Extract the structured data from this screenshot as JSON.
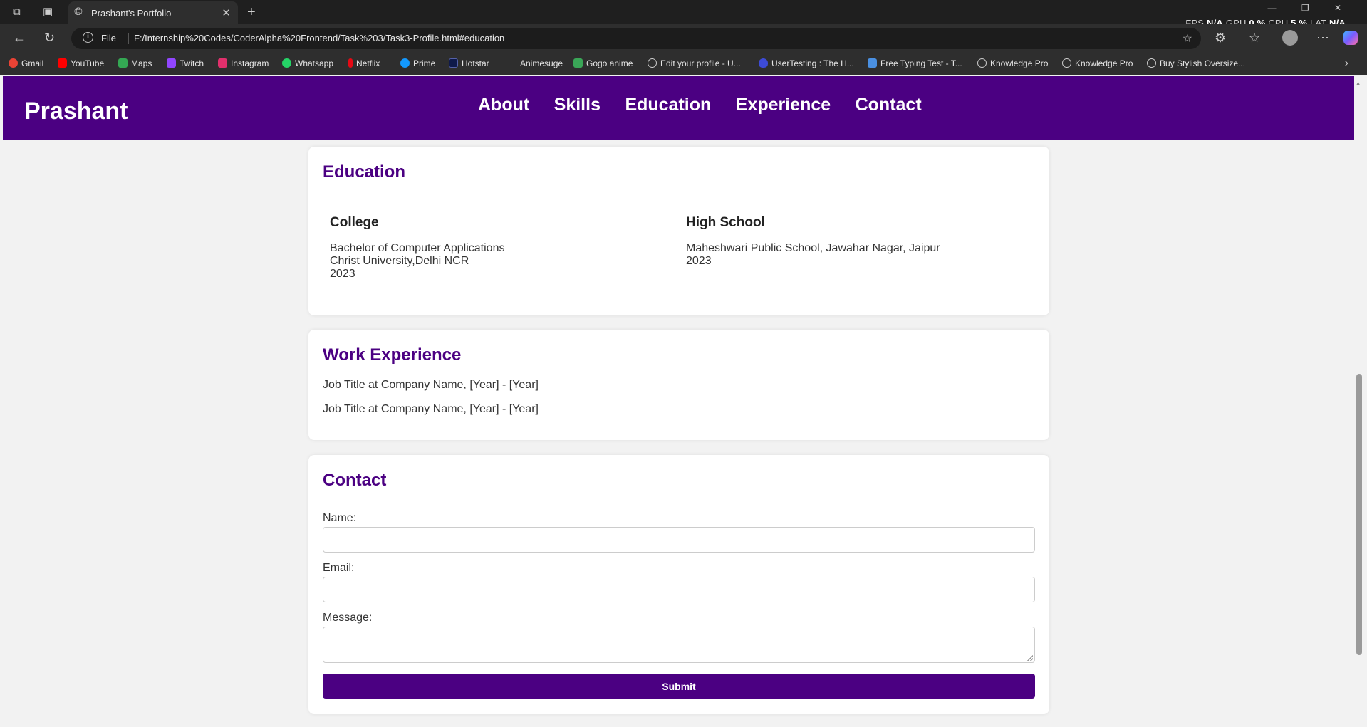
{
  "browser": {
    "tab_title": "Prashant's Portfolio",
    "address_prefix": "File",
    "url": "F:/Internship%20Codes/CoderAlpha%20Frontend/Task%203/Task3-Profile.html#education",
    "stats": {
      "fps_label": "FPS",
      "fps_value": "N/A",
      "gpu_label": "GPU",
      "gpu_value": "0 %",
      "cpu_label": "CPU",
      "cpu_value": "5 %",
      "lat_label": "LAT",
      "lat_value": "N/A"
    },
    "bookmarks": [
      {
        "label": "Gmail",
        "icon": "gmail-icon",
        "color": "#ea4335"
      },
      {
        "label": "YouTube",
        "icon": "youtube-icon",
        "color": "#ff0000"
      },
      {
        "label": "Maps",
        "icon": "maps-icon",
        "color": "#34a853"
      },
      {
        "label": "Twitch",
        "icon": "twitch-icon",
        "color": "#9146ff"
      },
      {
        "label": "Instagram",
        "icon": "instagram-icon",
        "color": "#e1306c"
      },
      {
        "label": "Whatsapp",
        "icon": "whatsapp-icon",
        "color": "#25d366"
      },
      {
        "label": "Netflix",
        "icon": "netflix-icon",
        "color": "#e50914"
      },
      {
        "label": "Prime",
        "icon": "prime-icon",
        "color": "#1399ff"
      },
      {
        "label": "Hotstar",
        "icon": "hotstar-icon",
        "color": "#0f1a4a"
      },
      {
        "label": "Animesuge",
        "icon": "animesuge-icon",
        "color": "#2e2e2e"
      },
      {
        "label": "Gogo anime",
        "icon": "gogoanime-icon",
        "color": "#3aa657"
      },
      {
        "label": "Edit your profile - U...",
        "icon": "globe-icon",
        "color": "#2e2e2e"
      },
      {
        "label": "UserTesting : The H...",
        "icon": "usertesting-icon",
        "color": "#3d4bd6"
      },
      {
        "label": "Free Typing Test - T...",
        "icon": "typing-icon",
        "color": "#4a90e2"
      },
      {
        "label": "Knowledge Pro",
        "icon": "globe-icon",
        "color": "#2e2e2e"
      },
      {
        "label": "Knowledge Pro",
        "icon": "globe-icon",
        "color": "#2e2e2e"
      },
      {
        "label": "Buy Stylish Oversize...",
        "icon": "globe-icon",
        "color": "#2e2e2e"
      }
    ]
  },
  "site": {
    "brand": "Prashant",
    "nav": [
      "About",
      "Skills",
      "Education",
      "Experience",
      "Contact"
    ],
    "accent": "#4b0082"
  },
  "education": {
    "title": "Education",
    "college": {
      "heading": "College",
      "lines": [
        "Bachelor of Computer Applications",
        "Christ University,Delhi NCR",
        "2023"
      ]
    },
    "school": {
      "heading": "High School",
      "lines": [
        "Maheshwari Public School, Jawahar Nagar, Jaipur",
        "2023"
      ]
    }
  },
  "experience": {
    "title": "Work Experience",
    "jobs": [
      "Job Title at Company Name, [Year] - [Year]",
      "Job Title at Company Name, [Year] - [Year]"
    ]
  },
  "contact": {
    "title": "Contact",
    "name_label": "Name:",
    "email_label": "Email:",
    "message_label": "Message:",
    "submit_label": "Submit"
  }
}
